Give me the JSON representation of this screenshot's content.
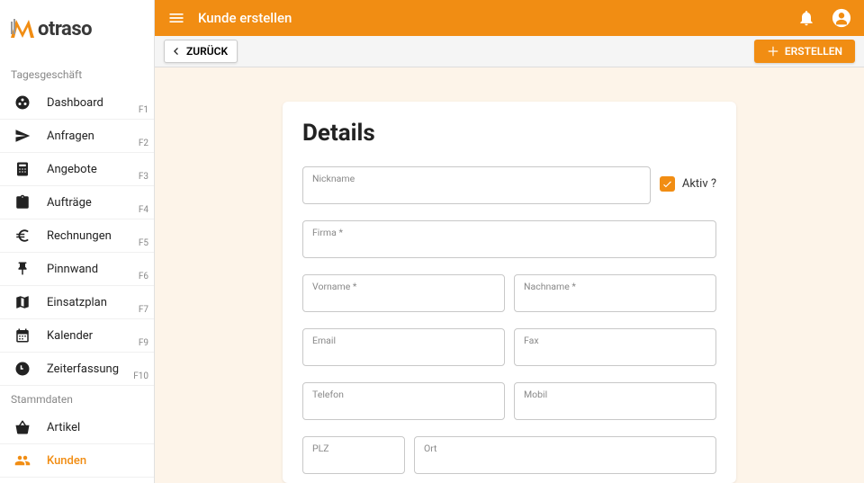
{
  "brand": {
    "name": "otraso"
  },
  "header": {
    "title": "Kunde erstellen"
  },
  "actions": {
    "back": "ZURÜCK",
    "create": "ERSTELLEN"
  },
  "sidebar": {
    "sections": [
      {
        "title": "Tagesgeschäft"
      },
      {
        "title": "Stammdaten"
      }
    ],
    "items": [
      {
        "label": "Dashboard",
        "shortcut": "F1"
      },
      {
        "label": "Anfragen",
        "shortcut": "F2"
      },
      {
        "label": "Angebote",
        "shortcut": "F3"
      },
      {
        "label": "Aufträge",
        "shortcut": "F4"
      },
      {
        "label": "Rechnungen",
        "shortcut": "F5"
      },
      {
        "label": "Pinnwand",
        "shortcut": "F6"
      },
      {
        "label": "Einsatzplan",
        "shortcut": "F7"
      },
      {
        "label": "Kalender",
        "shortcut": "F9"
      },
      {
        "label": "Zeiterfassung",
        "shortcut": "F10"
      },
      {
        "label": "Artikel",
        "shortcut": ""
      },
      {
        "label": "Kunden",
        "shortcut": ""
      }
    ]
  },
  "form": {
    "title": "Details",
    "active_label": "Aktiv ?",
    "fields": {
      "nickname": "Nickname",
      "firma": "Firma *",
      "vorname": "Vorname *",
      "nachname": "Nachname *",
      "email": "Email",
      "fax": "Fax",
      "telefon": "Telefon",
      "mobil": "Mobil",
      "plz": "PLZ",
      "ort": "Ort"
    }
  }
}
